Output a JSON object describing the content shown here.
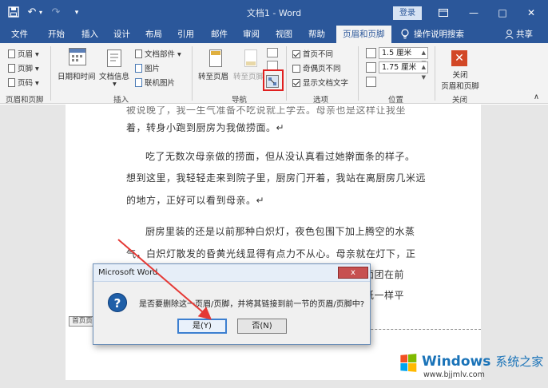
{
  "titlebar": {
    "doc_title": "文档1 - Word",
    "login_label": "登录",
    "quick_access": {
      "undo_glyph": "↶",
      "redo_glyph": "↷",
      "more_glyph": "▾"
    },
    "window_controls": {
      "minimize": "—",
      "maximize": "□",
      "close": "✕"
    }
  },
  "tabs": [
    {
      "label": "文件"
    },
    {
      "label": "开始"
    },
    {
      "label": "插入"
    },
    {
      "label": "设计"
    },
    {
      "label": "布局"
    },
    {
      "label": "引用"
    },
    {
      "label": "邮件"
    },
    {
      "label": "审阅"
    },
    {
      "label": "视图"
    },
    {
      "label": "帮助"
    },
    {
      "label": "页眉和页脚",
      "active": true
    }
  ],
  "tell_me": "操作说明搜索",
  "share": "共享",
  "ribbon": {
    "header_footer_group": {
      "label": "页眉和页脚",
      "items": [
        "页眉",
        "页脚",
        "页码"
      ]
    },
    "insert_group": {
      "label": "插入",
      "date_time": "日期和时间",
      "doc_info": "文档信息",
      "doc_parts": "文档部件",
      "picture": "图片",
      "online_picture": "联机图片"
    },
    "navigation_group": {
      "label": "导航",
      "goto_header": "转至页眉",
      "goto_footer": "转至页脚"
    },
    "options_group": {
      "label": "选项",
      "different_first_page": "首页不同",
      "different_odd_even": "奇偶页不同",
      "show_document_text": "显示文档文字",
      "checked": [
        true,
        false,
        true
      ]
    },
    "position_group": {
      "label": "位置",
      "header_from_top": "1.5 厘米",
      "footer_from_bottom": "1.75 厘米"
    },
    "close_group": {
      "label": "关闭",
      "button_line1": "关闭",
      "button_line2": "页眉和页脚"
    }
  },
  "document": {
    "lines": [
      "被说晚了，我一生气准备不吃说就上学去。母亲也是这样让我坐",
      "着，转身小跑到厨房为我做捞面。↵",
      "吃了无数次母亲做的捞面，但从没认真看过她擀面条的样子。",
      "想到这里，我轻轻走来到院子里，厨房门开着，我站在离厨房几米远",
      "的地方，正好可以看到母亲。↵",
      "厨房里装的还是以前那种白炽灯，夜色包围下加上腾空的水蒸",
      "气，白炽灯散发的昏黄光线显得有点力不从心。母亲就在灯下，正",
      "面团在前",
      "纸一样平"
    ],
    "header_tag": "首页页"
  },
  "dialog": {
    "title": "Microsoft Word",
    "close_glyph": "x",
    "message": "是否要删除这一页眉/页脚，并将其链接到前一节的页眉/页脚中?",
    "yes_button": "是(Y)",
    "no_button": "否(N)"
  },
  "watermark": {
    "title": "Windows",
    "title_cn": "系统之家",
    "url": "www.bjjmlv.com",
    "colors": [
      "#f25022",
      "#7fba00",
      "#00a4ef",
      "#ffb900"
    ]
  },
  "colors": {
    "word_blue": "#2b579a",
    "highlight_red": "#e02020",
    "arrow_red": "#e53935"
  }
}
